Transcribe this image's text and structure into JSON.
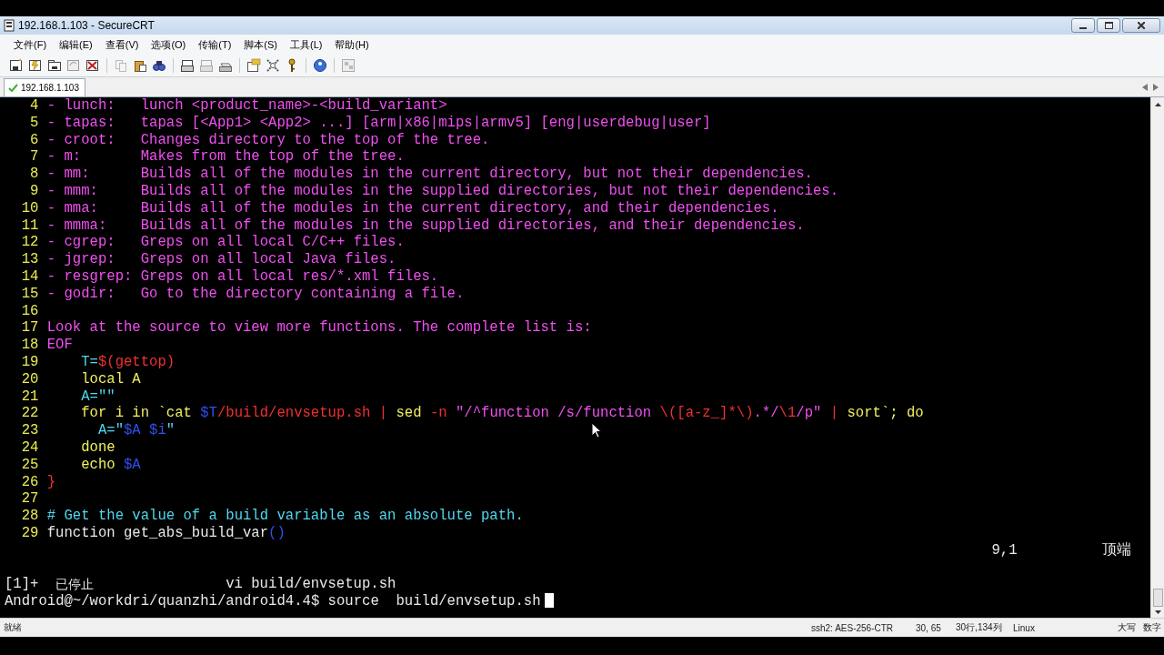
{
  "window": {
    "title": "192.168.1.103 - SecureCRT"
  },
  "menu": [
    "文件(F)",
    "编辑(E)",
    "查看(V)",
    "选项(O)",
    "传输(T)",
    "脚本(S)",
    "工具(L)",
    "帮助(H)"
  ],
  "tabs": [
    {
      "label": "192.168.1.103",
      "selected": true,
      "connected": true
    }
  ],
  "editor": {
    "lines": [
      {
        "number": "4",
        "segments": [
          {
            "text": "- lunch:   lunch <product_name>-<build_variant>",
            "color": "#f050f0"
          }
        ]
      },
      {
        "number": "5",
        "segments": [
          {
            "text": "- tapas:   tapas [<App1> <App2> ...] [arm|x86|mips|armv5] [eng|userdebug|user]",
            "color": "#f050f0"
          }
        ]
      },
      {
        "number": "6",
        "segments": [
          {
            "text": "- croot:   Changes directory to the top of the tree.",
            "color": "#f050f0"
          }
        ]
      },
      {
        "number": "7",
        "segments": [
          {
            "text": "- m:       Makes from the top of the tree.",
            "color": "#f050f0"
          }
        ]
      },
      {
        "number": "8",
        "segments": [
          {
            "text": "- mm:      Builds all of the modules in the current directory, but not their dependencies.",
            "color": "#f050f0"
          }
        ]
      },
      {
        "number": "9",
        "segments": [
          {
            "text": "- mmm:     Builds all of the modules in the supplied directories, but not their dependencies.",
            "color": "#f050f0"
          }
        ]
      },
      {
        "number": "10",
        "segments": [
          {
            "text": "- mma:     Builds all of the modules in the current directory, and their dependencies.",
            "color": "#f050f0"
          }
        ]
      },
      {
        "number": "11",
        "segments": [
          {
            "text": "- mmma:    Builds all of the modules in the supplied directories, and their dependencies.",
            "color": "#f050f0"
          }
        ]
      },
      {
        "number": "12",
        "segments": [
          {
            "text": "- cgrep:   Greps on all local C/C++ files.",
            "color": "#f050f0"
          }
        ]
      },
      {
        "number": "13",
        "segments": [
          {
            "text": "- jgrep:   Greps on all local Java files.",
            "color": "#f050f0"
          }
        ]
      },
      {
        "number": "14",
        "segments": [
          {
            "text": "- resgrep: Greps on all local res/*.xml files.",
            "color": "#f050f0"
          }
        ]
      },
      {
        "number": "15",
        "segments": [
          {
            "text": "- godir:   Go to the directory containing a file.",
            "color": "#f050f0"
          }
        ]
      },
      {
        "number": "16"
      },
      {
        "number": "17",
        "segments": [
          {
            "text": "Look at the source to view more functions. The complete list is:",
            "color": "#f050f0"
          }
        ]
      },
      {
        "number": "18",
        "segments": [
          {
            "text": "EOF",
            "color": "#f050f0"
          }
        ]
      },
      {
        "number": "19",
        "segments": [
          {
            "text": "    T=",
            "color": "#50d8f0"
          },
          {
            "text": "$(gettop)",
            "color": "#f03030"
          }
        ]
      },
      {
        "number": "20",
        "segments": [
          {
            "text": "    local A",
            "color": "#f0f060"
          }
        ]
      },
      {
        "number": "21",
        "segments": [
          {
            "text": "    A=\"\"",
            "color": "#50d8f0"
          }
        ]
      },
      {
        "number": "22",
        "segments": [
          {
            "text": "    for i in `cat ",
            "color": "#f0f060"
          },
          {
            "text": "$T",
            "color": "#3050f0"
          },
          {
            "text": "/build/envsetup.sh | ",
            "color": "#f03030"
          },
          {
            "text": "sed ",
            "color": "#f0f060"
          },
          {
            "text": "-n ",
            "color": "#f03030"
          },
          {
            "text": "\"/^function /s/function ",
            "color": "#f050f0"
          },
          {
            "text": "\\([a-z_]*\\)",
            "color": "#f03030"
          },
          {
            "text": ".*/",
            "color": "#f050f0"
          },
          {
            "text": "\\1",
            "color": "#f03030"
          },
          {
            "text": "/p\"",
            "color": "#f050f0"
          },
          {
            "text": " | ",
            "color": "#f03030"
          },
          {
            "text": "sort`; do",
            "color": "#f0f060"
          }
        ]
      },
      {
        "number": "23",
        "segments": [
          {
            "text": "      A=\"",
            "color": "#50d8f0"
          },
          {
            "text": "$A $i",
            "color": "#3050f0"
          },
          {
            "text": "\"",
            "color": "#50d8f0"
          }
        ]
      },
      {
        "number": "24",
        "segments": [
          {
            "text": "    done",
            "color": "#f0f060"
          }
        ]
      },
      {
        "number": "25",
        "segments": [
          {
            "text": "    echo ",
            "color": "#f0f060"
          },
          {
            "text": "$A",
            "color": "#3050f0"
          }
        ]
      },
      {
        "number": "26",
        "segments": [
          {
            "text": "}",
            "color": "#f03030"
          }
        ]
      },
      {
        "number": "27"
      },
      {
        "number": "28",
        "segments": [
          {
            "text": "# Get the value of a build variable as an absolute path.",
            "color": "#50d8f0"
          }
        ]
      },
      {
        "number": "29",
        "segments": [
          {
            "text": "function get_abs_build_var",
            "color": "#e8e8e8"
          },
          {
            "text": "()",
            "color": "#3050f0"
          }
        ]
      }
    ],
    "ruler": "9,1",
    "position": "顶端"
  },
  "shell": {
    "job_id": "[1]+",
    "job_state": "已停止",
    "job_command": "vi build/envsetup.sh",
    "prompt": "Android@~/workdri/quanzhi/android4.4$ source  build/envsetup.sh"
  },
  "status_bar": [
    "就绪",
    "ssh2: AES-256-CTR",
    "30, 65",
    "30行,134列",
    "Linux",
    "大写",
    "数字"
  ]
}
